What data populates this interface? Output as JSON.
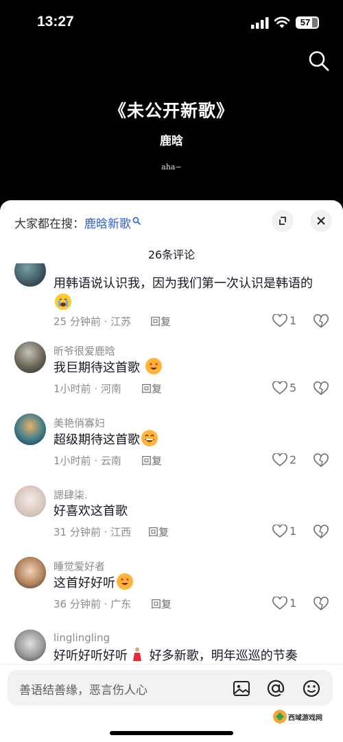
{
  "status_bar": {
    "time": "13:27",
    "battery": "57"
  },
  "header": {
    "title": "《未公开新歌》",
    "artist": "鹿晗",
    "sub": "aha~"
  },
  "sheet": {
    "hot_search_label": "大家都在搜：",
    "hot_search_keyword": "鹿晗新歌",
    "comment_count": "26条评论"
  },
  "comments": [
    {
      "user": "",
      "text": "用韩语说认识我，因为我们第一次认识是韩语的",
      "emoji": "loudly-crying-emoji",
      "time_loc": "25 分钟前 · 江苏",
      "reply": "回复",
      "likes": "1"
    },
    {
      "user": "昕爷很爱鹿晗",
      "text": "我巨期待这首歌",
      "emoji": "heart-eyes-emoji",
      "time_loc": "1小时前 · 河南",
      "reply": "回复",
      "likes": "5"
    },
    {
      "user": "美艳俏寡妇",
      "text": "超级期待这首歌",
      "emoji": "grinning-emoji",
      "time_loc": "1小时前 · 云南",
      "reply": "回复",
      "likes": "2"
    },
    {
      "user": "諰肆柒.",
      "text": "好喜欢这首歌",
      "emoji": "",
      "time_loc": "31 分钟前 · 江西",
      "reply": "回复",
      "likes": "1"
    },
    {
      "user": "睡觉爱好者",
      "text": "这首好好听",
      "emoji": "heart-eyes-emoji",
      "time_loc": "36 分钟前 · 广东",
      "reply": "回复",
      "likes": "1"
    },
    {
      "user": "linglingling",
      "text": "好听好听好听",
      "text2": "好多新歌，明年巡巡的节奏",
      "emoji": "dancer-emoji",
      "time_loc": "",
      "reply": "",
      "likes": ""
    }
  ],
  "input_bar": {
    "placeholder": "善语结善缘，恶言伤人心"
  },
  "watermark": {
    "text": "西域游戏网"
  },
  "colors": {
    "accent_link": "#2a5bd7",
    "meta_gray": "#8a8b91",
    "text": "#161823"
  }
}
